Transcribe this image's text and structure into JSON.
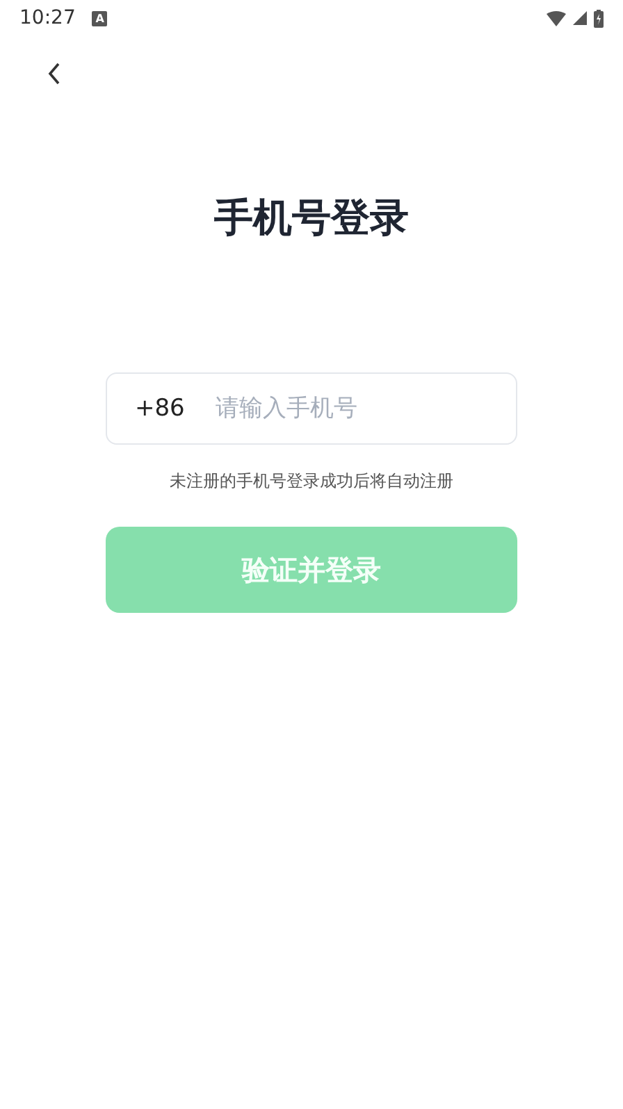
{
  "status_bar": {
    "time": "10:27",
    "notification": "A"
  },
  "title": "手机号登录",
  "phone_field": {
    "country_code": "+86",
    "placeholder": "请输入手机号"
  },
  "hint": "未注册的手机号登录成功后将自动注册",
  "submit_button": {
    "label": "验证并登录",
    "disabled": true
  }
}
